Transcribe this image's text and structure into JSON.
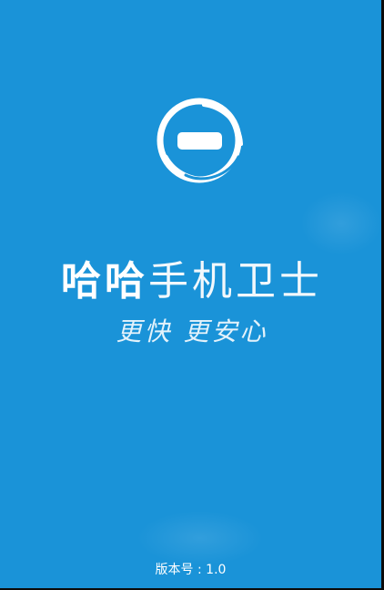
{
  "splash": {
    "app_name_bold": "哈哈",
    "app_name_light": "手机卫士",
    "slogan": "更快 更安心",
    "version_text": "版本号 : 1.0",
    "logo_icon": "shield-minus-logo-icon"
  },
  "colors": {
    "background": "#1a93d8",
    "text": "#ffffff",
    "frame": "#0b0b0b"
  }
}
